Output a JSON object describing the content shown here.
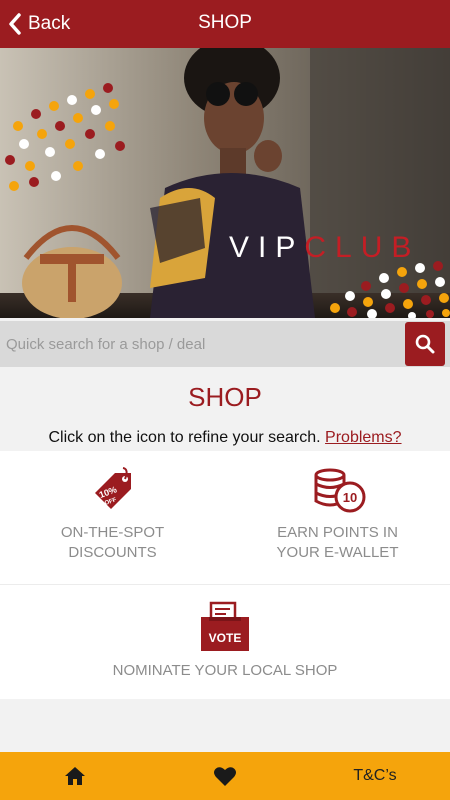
{
  "header": {
    "back_label": "Back",
    "title": "SHOP"
  },
  "hero": {
    "brand_part1": "VIP",
    "brand_part2": "CLUB"
  },
  "search": {
    "placeholder": "Quick search for a shop / deal"
  },
  "main": {
    "title": "SHOP",
    "instruction": "Click on the icon to refine your search.",
    "problems_link": "Problems?",
    "tiles": [
      {
        "label_line1": "ON-THE-SPOT",
        "label_line2": "DISCOUNTS",
        "icon": "discount-tag-icon",
        "badge_top": "10%",
        "badge_bottom": "OFF"
      },
      {
        "label_line1": "EARN POINTS IN",
        "label_line2": "YOUR E-WALLET",
        "icon": "coins-icon",
        "coin_value": "10"
      },
      {
        "label_line1": "NOMINATE YOUR LOCAL SHOP",
        "icon": "vote-box-icon",
        "box_text": "VOTE"
      }
    ]
  },
  "bottom_nav": {
    "home_icon": "home-icon",
    "favorites_icon": "heart-icon",
    "tc_label": "T&C’s"
  },
  "colors": {
    "brand_red": "#9b1c20",
    "nav_orange": "#f5a40c",
    "label_gray": "#8c8c8c"
  }
}
